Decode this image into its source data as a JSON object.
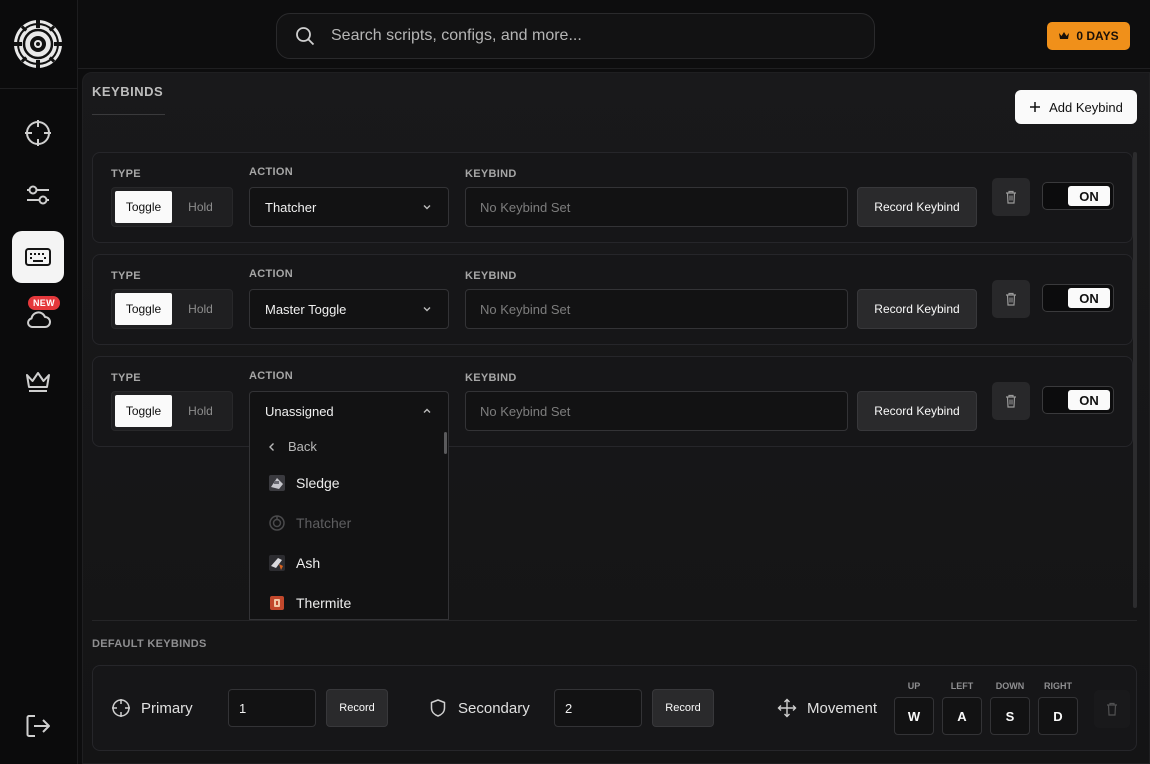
{
  "header": {
    "search_placeholder": "Search scripts, configs, and more...",
    "days_label": "0 DAYS"
  },
  "sidebar": {
    "items": [
      {
        "name": "crosshair-icon"
      },
      {
        "name": "sliders-icon"
      },
      {
        "name": "keyboard-icon",
        "active": true
      },
      {
        "name": "cloud-icon",
        "badge": "NEW"
      },
      {
        "name": "crown-icon"
      }
    ],
    "badge_new": "NEW",
    "signout": "sign-out-icon"
  },
  "keybinds": {
    "title": "KEYBINDS",
    "add_label": "Add Keybind",
    "type_label": "TYPE",
    "action_label": "ACTION",
    "keybind_label": "KEYBIND",
    "toggle_label": "Toggle",
    "hold_label": "Hold",
    "record_label": "Record Keybind",
    "on_label": "ON",
    "rows": [
      {
        "action": "Thatcher",
        "keybind_placeholder": "No Keybind Set",
        "type": "Toggle",
        "enabled": "ON"
      },
      {
        "action": "Master Toggle",
        "keybind_placeholder": "No Keybind Set",
        "type": "Toggle",
        "enabled": "ON"
      },
      {
        "action": "Unassigned",
        "keybind_placeholder": "No Keybind Set",
        "type": "Toggle",
        "enabled": "ON"
      }
    ]
  },
  "dropdown": {
    "back_label": "Back",
    "items": [
      {
        "label": "Sledge",
        "disabled": false
      },
      {
        "label": "Thatcher",
        "disabled": true
      },
      {
        "label": "Ash",
        "disabled": false
      },
      {
        "label": "Thermite",
        "disabled": false
      }
    ]
  },
  "default_keybinds": {
    "title": "DEFAULT KEYBINDS",
    "primary_label": "Primary",
    "primary_value": "1",
    "secondary_label": "Secondary",
    "secondary_value": "2",
    "record_label": "Record",
    "movement_label": "Movement",
    "directions": [
      {
        "label": "UP",
        "key": "W"
      },
      {
        "label": "LEFT",
        "key": "A"
      },
      {
        "label": "DOWN",
        "key": "S"
      },
      {
        "label": "RIGHT",
        "key": "D"
      }
    ]
  },
  "colors": {
    "accent": "#f0901a",
    "badge": "#e5383b",
    "background": "#0d0d0e"
  }
}
